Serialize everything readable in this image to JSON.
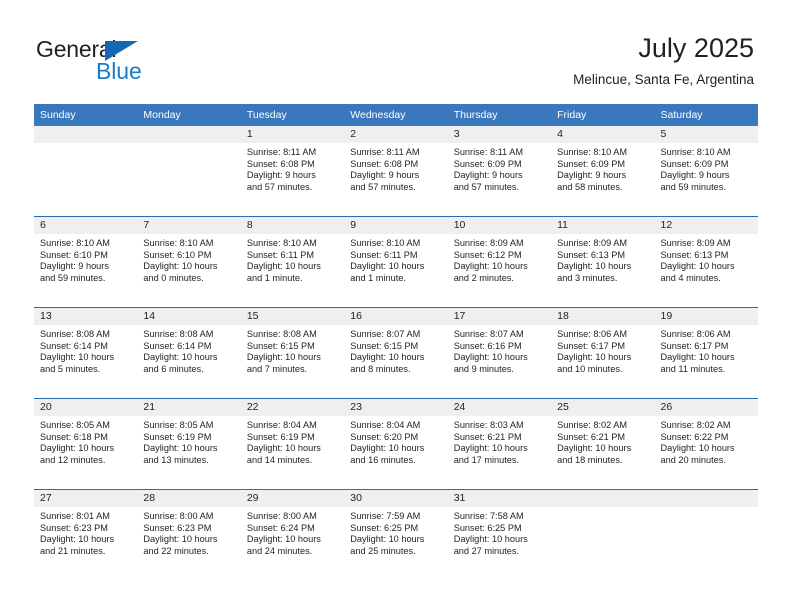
{
  "logo": {
    "word1": "General",
    "word2": "Blue",
    "triangle_color": "#1468b3",
    "blue_text_color": "#1a7cc8"
  },
  "header": {
    "title": "July 2025",
    "subtitle": "Melincue, Santa Fe, Argentina"
  },
  "theme": {
    "header_bg": "#3a78be",
    "row_divider": "#2d6daf",
    "daynum_band_bg": "#efefef",
    "text": "#231f20"
  },
  "weekday_headers": [
    "Sunday",
    "Monday",
    "Tuesday",
    "Wednesday",
    "Thursday",
    "Friday",
    "Saturday"
  ],
  "weeks": [
    [
      {
        "day": "",
        "sunrise": "",
        "sunset": "",
        "daylight_line1": "",
        "daylight_line2": ""
      },
      {
        "day": "",
        "sunrise": "",
        "sunset": "",
        "daylight_line1": "",
        "daylight_line2": ""
      },
      {
        "day": "1",
        "sunrise": "Sunrise: 8:11 AM",
        "sunset": "Sunset: 6:08 PM",
        "daylight_line1": "Daylight: 9 hours",
        "daylight_line2": "and 57 minutes."
      },
      {
        "day": "2",
        "sunrise": "Sunrise: 8:11 AM",
        "sunset": "Sunset: 6:08 PM",
        "daylight_line1": "Daylight: 9 hours",
        "daylight_line2": "and 57 minutes."
      },
      {
        "day": "3",
        "sunrise": "Sunrise: 8:11 AM",
        "sunset": "Sunset: 6:09 PM",
        "daylight_line1": "Daylight: 9 hours",
        "daylight_line2": "and 57 minutes."
      },
      {
        "day": "4",
        "sunrise": "Sunrise: 8:10 AM",
        "sunset": "Sunset: 6:09 PM",
        "daylight_line1": "Daylight: 9 hours",
        "daylight_line2": "and 58 minutes."
      },
      {
        "day": "5",
        "sunrise": "Sunrise: 8:10 AM",
        "sunset": "Sunset: 6:09 PM",
        "daylight_line1": "Daylight: 9 hours",
        "daylight_line2": "and 59 minutes."
      }
    ],
    [
      {
        "day": "6",
        "sunrise": "Sunrise: 8:10 AM",
        "sunset": "Sunset: 6:10 PM",
        "daylight_line1": "Daylight: 9 hours",
        "daylight_line2": "and 59 minutes."
      },
      {
        "day": "7",
        "sunrise": "Sunrise: 8:10 AM",
        "sunset": "Sunset: 6:10 PM",
        "daylight_line1": "Daylight: 10 hours",
        "daylight_line2": "and 0 minutes."
      },
      {
        "day": "8",
        "sunrise": "Sunrise: 8:10 AM",
        "sunset": "Sunset: 6:11 PM",
        "daylight_line1": "Daylight: 10 hours",
        "daylight_line2": "and 1 minute."
      },
      {
        "day": "9",
        "sunrise": "Sunrise: 8:10 AM",
        "sunset": "Sunset: 6:11 PM",
        "daylight_line1": "Daylight: 10 hours",
        "daylight_line2": "and 1 minute."
      },
      {
        "day": "10",
        "sunrise": "Sunrise: 8:09 AM",
        "sunset": "Sunset: 6:12 PM",
        "daylight_line1": "Daylight: 10 hours",
        "daylight_line2": "and 2 minutes."
      },
      {
        "day": "11",
        "sunrise": "Sunrise: 8:09 AM",
        "sunset": "Sunset: 6:13 PM",
        "daylight_line1": "Daylight: 10 hours",
        "daylight_line2": "and 3 minutes."
      },
      {
        "day": "12",
        "sunrise": "Sunrise: 8:09 AM",
        "sunset": "Sunset: 6:13 PM",
        "daylight_line1": "Daylight: 10 hours",
        "daylight_line2": "and 4 minutes."
      }
    ],
    [
      {
        "day": "13",
        "sunrise": "Sunrise: 8:08 AM",
        "sunset": "Sunset: 6:14 PM",
        "daylight_line1": "Daylight: 10 hours",
        "daylight_line2": "and 5 minutes."
      },
      {
        "day": "14",
        "sunrise": "Sunrise: 8:08 AM",
        "sunset": "Sunset: 6:14 PM",
        "daylight_line1": "Daylight: 10 hours",
        "daylight_line2": "and 6 minutes."
      },
      {
        "day": "15",
        "sunrise": "Sunrise: 8:08 AM",
        "sunset": "Sunset: 6:15 PM",
        "daylight_line1": "Daylight: 10 hours",
        "daylight_line2": "and 7 minutes."
      },
      {
        "day": "16",
        "sunrise": "Sunrise: 8:07 AM",
        "sunset": "Sunset: 6:15 PM",
        "daylight_line1": "Daylight: 10 hours",
        "daylight_line2": "and 8 minutes."
      },
      {
        "day": "17",
        "sunrise": "Sunrise: 8:07 AM",
        "sunset": "Sunset: 6:16 PM",
        "daylight_line1": "Daylight: 10 hours",
        "daylight_line2": "and 9 minutes."
      },
      {
        "day": "18",
        "sunrise": "Sunrise: 8:06 AM",
        "sunset": "Sunset: 6:17 PM",
        "daylight_line1": "Daylight: 10 hours",
        "daylight_line2": "and 10 minutes."
      },
      {
        "day": "19",
        "sunrise": "Sunrise: 8:06 AM",
        "sunset": "Sunset: 6:17 PM",
        "daylight_line1": "Daylight: 10 hours",
        "daylight_line2": "and 11 minutes."
      }
    ],
    [
      {
        "day": "20",
        "sunrise": "Sunrise: 8:05 AM",
        "sunset": "Sunset: 6:18 PM",
        "daylight_line1": "Daylight: 10 hours",
        "daylight_line2": "and 12 minutes."
      },
      {
        "day": "21",
        "sunrise": "Sunrise: 8:05 AM",
        "sunset": "Sunset: 6:19 PM",
        "daylight_line1": "Daylight: 10 hours",
        "daylight_line2": "and 13 minutes."
      },
      {
        "day": "22",
        "sunrise": "Sunrise: 8:04 AM",
        "sunset": "Sunset: 6:19 PM",
        "daylight_line1": "Daylight: 10 hours",
        "daylight_line2": "and 14 minutes."
      },
      {
        "day": "23",
        "sunrise": "Sunrise: 8:04 AM",
        "sunset": "Sunset: 6:20 PM",
        "daylight_line1": "Daylight: 10 hours",
        "daylight_line2": "and 16 minutes."
      },
      {
        "day": "24",
        "sunrise": "Sunrise: 8:03 AM",
        "sunset": "Sunset: 6:21 PM",
        "daylight_line1": "Daylight: 10 hours",
        "daylight_line2": "and 17 minutes."
      },
      {
        "day": "25",
        "sunrise": "Sunrise: 8:02 AM",
        "sunset": "Sunset: 6:21 PM",
        "daylight_line1": "Daylight: 10 hours",
        "daylight_line2": "and 18 minutes."
      },
      {
        "day": "26",
        "sunrise": "Sunrise: 8:02 AM",
        "sunset": "Sunset: 6:22 PM",
        "daylight_line1": "Daylight: 10 hours",
        "daylight_line2": "and 20 minutes."
      }
    ],
    [
      {
        "day": "27",
        "sunrise": "Sunrise: 8:01 AM",
        "sunset": "Sunset: 6:23 PM",
        "daylight_line1": "Daylight: 10 hours",
        "daylight_line2": "and 21 minutes."
      },
      {
        "day": "28",
        "sunrise": "Sunrise: 8:00 AM",
        "sunset": "Sunset: 6:23 PM",
        "daylight_line1": "Daylight: 10 hours",
        "daylight_line2": "and 22 minutes."
      },
      {
        "day": "29",
        "sunrise": "Sunrise: 8:00 AM",
        "sunset": "Sunset: 6:24 PM",
        "daylight_line1": "Daylight: 10 hours",
        "daylight_line2": "and 24 minutes."
      },
      {
        "day": "30",
        "sunrise": "Sunrise: 7:59 AM",
        "sunset": "Sunset: 6:25 PM",
        "daylight_line1": "Daylight: 10 hours",
        "daylight_line2": "and 25 minutes."
      },
      {
        "day": "31",
        "sunrise": "Sunrise: 7:58 AM",
        "sunset": "Sunset: 6:25 PM",
        "daylight_line1": "Daylight: 10 hours",
        "daylight_line2": "and 27 minutes."
      },
      {
        "day": "",
        "sunrise": "",
        "sunset": "",
        "daylight_line1": "",
        "daylight_line2": ""
      },
      {
        "day": "",
        "sunrise": "",
        "sunset": "",
        "daylight_line1": "",
        "daylight_line2": ""
      }
    ]
  ]
}
